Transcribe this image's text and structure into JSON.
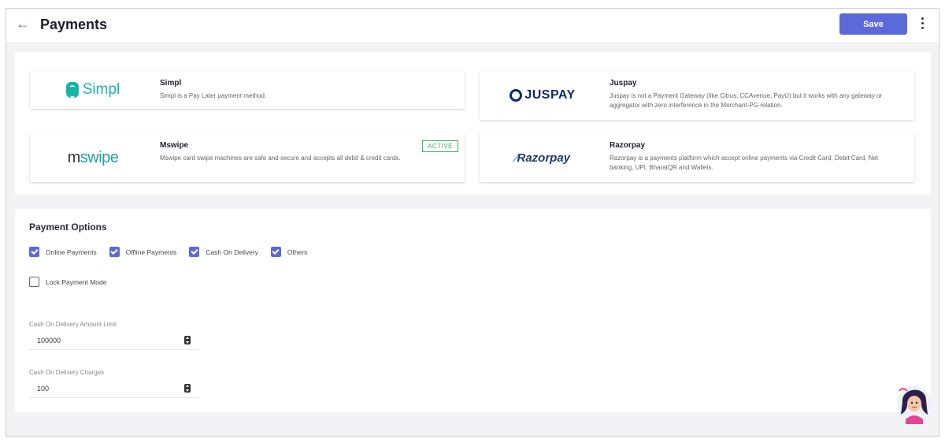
{
  "header": {
    "back_icon": "arrow-left-icon",
    "title": "Payments",
    "save_label": "Save",
    "menu_icon": "more-vertical-icon"
  },
  "gateways": [
    {
      "name": "Simpl",
      "logo_text": "Simpl",
      "description": "Simpl is a Pay Later payment method.",
      "active": false
    },
    {
      "name": "Juspay",
      "logo_text": "JUSPAY",
      "description": "Juspay is not a Payment Gateway (like Citrus, CCAvenue, PayU) but it works with any gateway or aggregator with zero interference in the Merchant-PG relation.",
      "active": false
    },
    {
      "name": "Mswipe",
      "logo_text_prefix": "m",
      "logo_text": "swipe",
      "description": "Mswipe card swipe machines are safe and secure and accepts all debit & credit cards.",
      "active": true,
      "badge": "ACTIVE"
    },
    {
      "name": "Razorpay",
      "logo_text": "Razorpay",
      "description": "Razorpay is a payments platform which accept online payments via Credit Card, Debit Card, Net banking, UPI, BharatQR and Wallets.",
      "active": false
    }
  ],
  "payment_options": {
    "title": "Payment Options",
    "options": [
      {
        "label": "Online Payments",
        "checked": true
      },
      {
        "label": "Offline Payments",
        "checked": true
      },
      {
        "label": "Cash On Delivery",
        "checked": true
      },
      {
        "label": "Others",
        "checked": true
      }
    ],
    "lock_mode": {
      "label": "Lock Payment Mode",
      "checked": false
    },
    "cod_limit": {
      "label": "Cash On Delivery Amount Limit",
      "value": "100000"
    },
    "cod_charges": {
      "label": "Cash On Delivery Charges",
      "value": "100"
    }
  },
  "colors": {
    "accent": "#5b6ad8",
    "active_badge": "#3fae6b",
    "simpl": "#19b3a8",
    "juspay": "#0d2a6b"
  },
  "assistant_icon": "assistant-avatar-icon"
}
